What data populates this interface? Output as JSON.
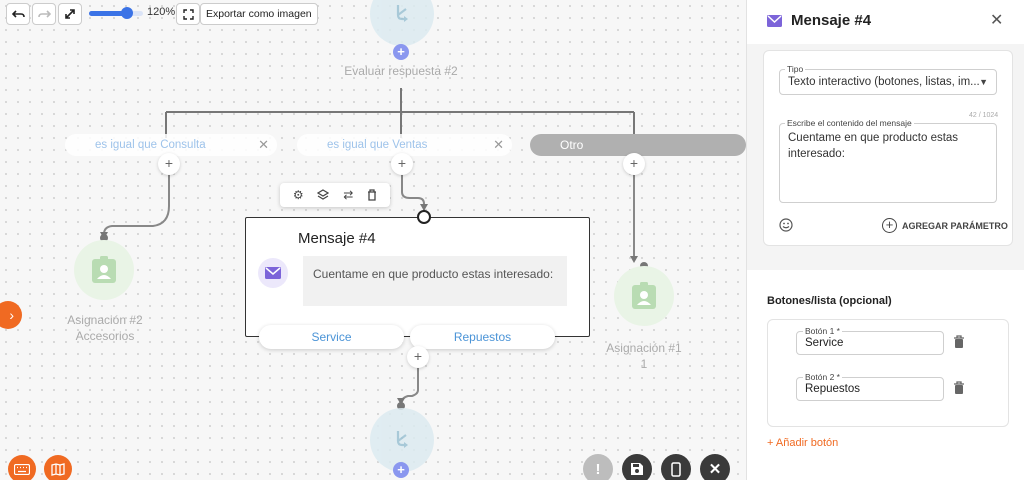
{
  "toolbar": {
    "zoom_percent": 120,
    "zoom_label": "120%",
    "export_label": "Exportar como imagen",
    "undo_icon": "undo-icon",
    "redo_icon": "redo-icon",
    "expand_icon": "expand-icon",
    "fit_icon": "fit-screen-icon"
  },
  "canvas": {
    "top_node_label": "Evaluar respuesta #2",
    "conditions": [
      {
        "label": "es igual que Consulta"
      },
      {
        "label": "es igual que Ventas"
      },
      {
        "label": "Otro"
      }
    ],
    "node_toolbar_icons": [
      "gear-icon",
      "layers-icon",
      "swap-icon",
      "trash-icon"
    ],
    "message_node": {
      "title": "Mensaje #4",
      "text": "Cuentame en que producto estas interesado:",
      "options": [
        "Service",
        "Repuestos"
      ]
    },
    "assign_left": {
      "line1": "Asignación #2",
      "line2": "Accesorios"
    },
    "assign_right": {
      "line1": "Asignación #1",
      "line2": "1"
    },
    "plus": "+",
    "close_x": "✕",
    "side_arrow": "›",
    "bottom_action_icons": [
      "alert-icon",
      "save-icon",
      "mobile-preview-icon",
      "close-icon"
    ],
    "colors": {
      "accent": "#3b73e6",
      "orange": "#f06a22",
      "purple": "#7c64d9",
      "link": "#4b94d7"
    }
  },
  "panel": {
    "title": "Mensaje #4",
    "close": "✕",
    "type_label": "Tipo",
    "type_value": "Texto interactivo (botones, listas, im...",
    "counter": "42 / 1024",
    "content_label": "Escribe el contenido del mensaje",
    "content_value": "Cuentame en que producto estas interesado:",
    "add_param": "AGREGAR PARÁMETRO",
    "buttons_section": "Botones/lista (opcional)",
    "buttons": [
      {
        "label": "Botón 1 *",
        "value": "Service"
      },
      {
        "label": "Botón 2 *",
        "value": "Repuestos"
      }
    ],
    "add_button": "+ Añadir botón"
  }
}
